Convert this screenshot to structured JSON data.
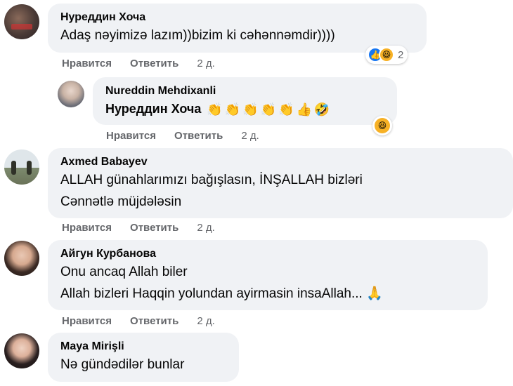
{
  "comments": [
    {
      "author": "Нуреддин Хоча",
      "lines": [
        "Adaş nəyimizə lazım))bizim ki cəhənnəmdir))))"
      ],
      "like_label": "Нравится",
      "reply_label": "Ответить",
      "time": "2 д.",
      "reaction_count": "2"
    },
    {
      "author": "Nureddin Mehdixanli",
      "mention": "Нуреддин Хоча",
      "emojis": [
        "👏",
        "👏",
        "👏",
        "👏",
        "👏",
        "👍",
        "🤣"
      ],
      "like_label": "Нравится",
      "reply_label": "Ответить",
      "time": "2 д."
    },
    {
      "author": "Axmed Babayev",
      "lines": [
        "ALLAH günahlarımızı bağışlasın, İNŞALLAH bizləri",
        "Cənnətlə müjdələsin"
      ],
      "like_label": "Нравится",
      "reply_label": "Ответить",
      "time": "2 д."
    },
    {
      "author": "Айгун Курбанова",
      "lines": [
        "Onu ancaq Allah biler",
        "Allah bizleri Haqqin yolundan ayirmasin insaAllah... 🙏"
      ],
      "like_label": "Нравится",
      "reply_label": "Ответить",
      "time": "2 д."
    },
    {
      "author": "Maya Mirişli",
      "lines": [
        "Nə gündədilər bunlar"
      ]
    }
  ],
  "colors": {
    "bubble": "#f0f2f5",
    "meta": "#65676b",
    "like": "#1877f2",
    "haha": "#f7b125"
  },
  "icons": {
    "like": "like-reaction-icon",
    "haha": "haha-reaction-icon"
  }
}
